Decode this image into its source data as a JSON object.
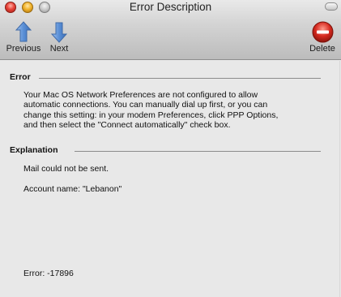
{
  "window": {
    "title": "Error Description"
  },
  "toolbar": {
    "previous_label": "Previous",
    "next_label": "Next",
    "delete_label": "Delete"
  },
  "error_section": {
    "heading": "Error",
    "lines": [
      "Your Mac OS Network Preferences are not configured to allow",
      "automatic connections. You can manually dial up first, or you can",
      "change this setting: in your modem Preferences, click PPP Options,",
      "and then select the \"Connect automatically\" check box."
    ]
  },
  "explanation_section": {
    "heading": "Explanation",
    "message": "Mail could not be sent.",
    "account": "Account name: \"Lebanon\""
  },
  "error_code": "Error: -17896",
  "colors": {
    "close": "#e8443a",
    "minimize": "#f2b52d",
    "arrow_blue": "#5a8fd6",
    "delete_red": "#d62a20"
  }
}
